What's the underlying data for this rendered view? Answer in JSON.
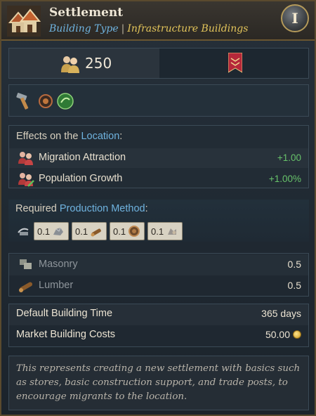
{
  "header": {
    "title": "Settlement",
    "type_key": "Building Type",
    "separator": "|",
    "type_value": "Infrastructure Buildings",
    "age_badge": "I",
    "icon": "settlement-houses-icon"
  },
  "stats": {
    "population_icon": "population-icon",
    "population_value": "250",
    "banner_icon": "estate-banner-icon"
  },
  "tools": {
    "icons": [
      "hammer-icon",
      "shield-ring-icon",
      "green-orb-icon"
    ]
  },
  "effects": {
    "heading_prefix": "Effects on the ",
    "heading_link": "Location",
    "heading_suffix": ":",
    "items": [
      {
        "icon": "migration-icon",
        "label": "Migration Attraction",
        "value": "+1.00"
      },
      {
        "icon": "population-growth-icon",
        "label": "Population Growth",
        "value": "+1.00%"
      }
    ],
    "positive_color": "#67c26a"
  },
  "production": {
    "heading_prefix": "Required ",
    "heading_link": "Production Method",
    "heading_suffix": ":",
    "method_icon": "input-method-icon",
    "chips": [
      {
        "value": "0.1",
        "icon": "stone-icon"
      },
      {
        "value": "0.1",
        "icon": "lumber-icon"
      },
      {
        "value": "0.1",
        "icon": "tools-icon"
      },
      {
        "value": "0.1",
        "icon": "goods-icon"
      }
    ]
  },
  "resources": [
    {
      "icon": "masonry-icon",
      "label": "Masonry",
      "value": "0.5"
    },
    {
      "icon": "lumber-icon",
      "label": "Lumber",
      "value": "0.5"
    }
  ],
  "costs": [
    {
      "label": "Default Building Time",
      "value": "365 days"
    },
    {
      "label": "Market Building Costs",
      "value": "50.00",
      "icon": "gold-coin-icon"
    }
  ],
  "description": "This represents creating a new settlement with basics such as stores, basic construction support, and trade posts, to encourage migrants to the location."
}
